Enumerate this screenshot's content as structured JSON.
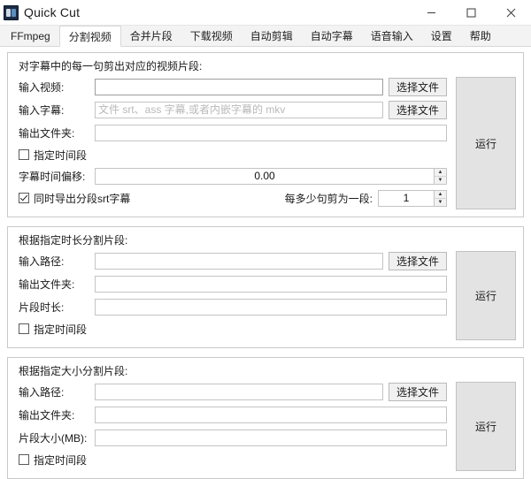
{
  "window": {
    "title": "Quick Cut",
    "icon": "app-icon",
    "controls": {
      "minimize": "minimize-icon",
      "maximize": "maximize-icon",
      "close": "close-icon"
    }
  },
  "tabs": [
    {
      "label": "FFmpeg",
      "active": false
    },
    {
      "label": "分割视频",
      "active": true
    },
    {
      "label": "合并片段",
      "active": false
    },
    {
      "label": "下载视频",
      "active": false
    },
    {
      "label": "自动剪辑",
      "active": false
    },
    {
      "label": "自动字幕",
      "active": false
    },
    {
      "label": "语音输入",
      "active": false
    },
    {
      "label": "设置",
      "active": false
    },
    {
      "label": "帮助",
      "active": false
    }
  ],
  "groups": [
    {
      "title": "对字幕中的每一句剪出对应的视频片段:",
      "input_video_label": "输入视频:",
      "input_video_value": "",
      "input_video_button": "选择文件",
      "input_subtitle_label": "输入字幕:",
      "input_subtitle_value": "",
      "input_subtitle_placeholder": "文件 srt、ass 字幕,或者内嵌字幕的 mkv",
      "input_subtitle_button": "选择文件",
      "output_folder_label": "输出文件夹:",
      "output_folder_value": "",
      "time_range_checkbox": "指定时间段",
      "time_range_checked": false,
      "offset_label": "字幕时间偏移:",
      "offset_value": "0.00",
      "export_srt_checkbox": "同时导出分段srt字幕",
      "export_srt_checked": true,
      "sentences_label": "每多少句剪为一段:",
      "sentences_value": "1",
      "run_button": "运行"
    },
    {
      "title": "根据指定时长分割片段:",
      "input_path_label": "输入路径:",
      "input_path_value": "",
      "input_path_button": "选择文件",
      "output_folder_label": "输出文件夹:",
      "output_folder_value": "",
      "duration_label": "片段时长:",
      "duration_value": "",
      "time_range_checkbox": "指定时间段",
      "time_range_checked": false,
      "run_button": "运行"
    },
    {
      "title": "根据指定大小分割片段:",
      "input_path_label": "输入路径:",
      "input_path_value": "",
      "input_path_button": "选择文件",
      "output_folder_label": "输出文件夹:",
      "output_folder_value": "",
      "size_label": "片段大小(MB):",
      "size_value": "",
      "time_range_checkbox": "指定时间段",
      "time_range_checked": false,
      "run_button": "运行"
    }
  ],
  "colors": {
    "accent": "#1c2b44",
    "button_face": "#f0f0f0",
    "run_face": "#e3e3e3",
    "border": "#c9c9c9"
  }
}
